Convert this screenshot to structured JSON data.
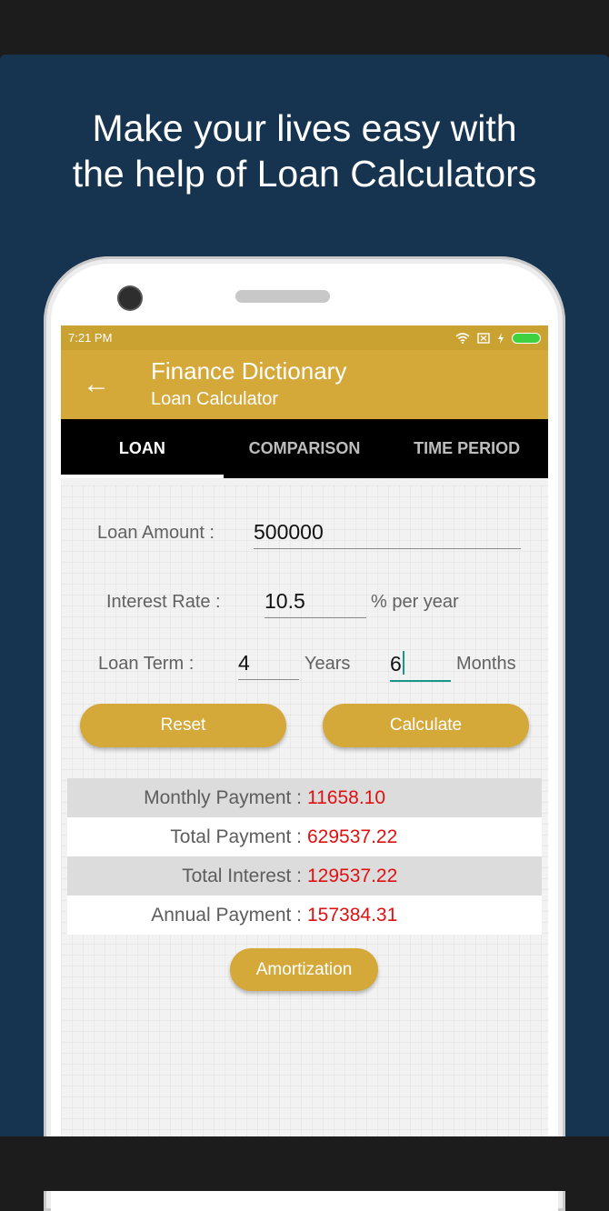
{
  "promo": {
    "headline_line1": "Make your lives easy with",
    "headline_line2": "the help of Loan Calculators"
  },
  "status": {
    "time": "7:21 PM",
    "icons": [
      "wifi-icon",
      "sim-icon",
      "charging-icon",
      "battery-icon"
    ]
  },
  "appbar": {
    "back_icon": "←",
    "title": "Finance Dictionary",
    "subtitle": "Loan Calculator"
  },
  "tabs": [
    {
      "label": "LOAN",
      "active": true
    },
    {
      "label": "COMPARISON",
      "active": false
    },
    {
      "label": "TIME PERIOD",
      "active": false
    }
  ],
  "form": {
    "loan_amount_label": "Loan Amount :",
    "loan_amount_value": "500000",
    "interest_rate_label": "Interest Rate :",
    "interest_rate_value": "10.5",
    "interest_unit": "% per year",
    "loan_term_label": "Loan Term :",
    "years_value": "4",
    "years_label": "Years",
    "months_value": "6",
    "months_label": "Months"
  },
  "buttons": {
    "reset": "Reset",
    "calculate": "Calculate",
    "amortization": "Amortization"
  },
  "results": [
    {
      "label": "Monthly Payment :",
      "value": "11658.10"
    },
    {
      "label": "Total Payment :",
      "value": "629537.22"
    },
    {
      "label": "Total Interest :",
      "value": "129537.22"
    },
    {
      "label": "Annual Payment :",
      "value": "157384.31"
    }
  ],
  "colors": {
    "accent": "#d4a93a",
    "background": "#163450",
    "result_value": "#e01010",
    "focus": "#18988b"
  }
}
